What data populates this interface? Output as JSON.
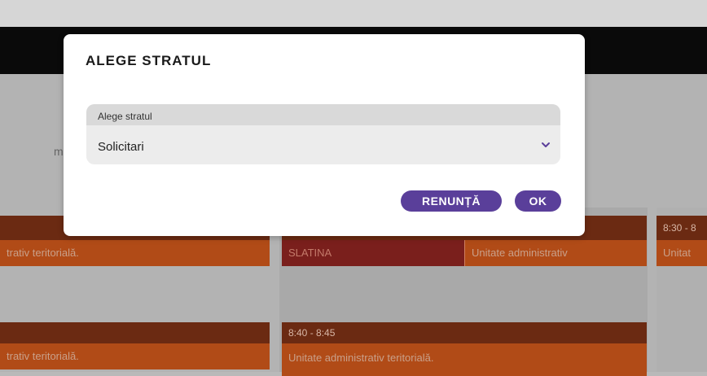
{
  "background": {
    "left_fragment": "m",
    "events": [
      {
        "time": "",
        "text": "trativ teritorială."
      },
      {
        "place": "SLATINA",
        "text": "Unitate administrativ"
      },
      {
        "time": "8:30 - 8",
        "text": "Unitat"
      },
      {
        "time": "",
        "text": "trativ teritorială."
      },
      {
        "time": "8:40 - 8:45",
        "text": "Unitate administrativ teritorială."
      }
    ]
  },
  "dialog": {
    "title": "ALEGE STRATUL",
    "select": {
      "label": "Alege stratul",
      "value": "Solicitari"
    },
    "cancel_label": "RENUNȚĂ",
    "ok_label": "OK"
  },
  "colors": {
    "accent": "#5a3f9a",
    "event_head": "#6b2a12",
    "event_body": "#b14b17",
    "event_place": "#7a1f1c"
  }
}
